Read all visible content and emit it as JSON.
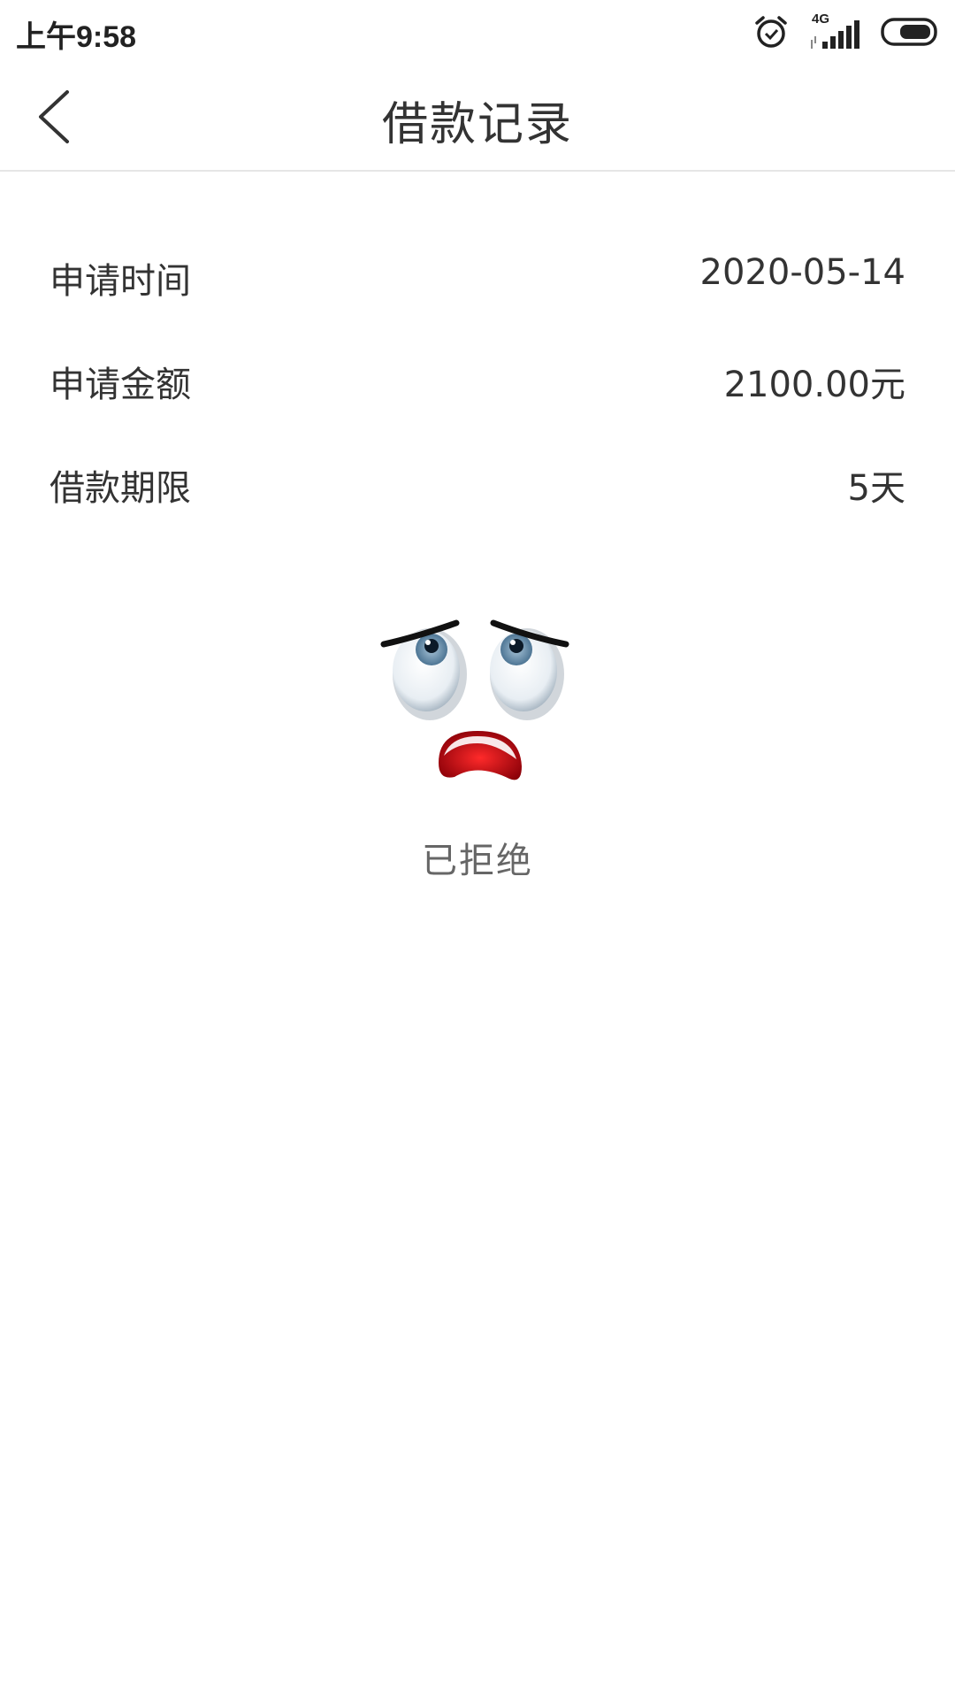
{
  "status_bar": {
    "time": "上午9:58",
    "network": "4G"
  },
  "nav": {
    "title": "借款记录"
  },
  "record": {
    "rows": [
      {
        "label": "申请时间",
        "value": "2020-05-14"
      },
      {
        "label": "申请金额",
        "value": "2100.00元"
      },
      {
        "label": "借款期限",
        "value": "5天"
      }
    ]
  },
  "result": {
    "status_text": "已拒绝",
    "icon": "sad-face-icon"
  },
  "colors": {
    "text_primary": "#333333",
    "text_secondary": "#666666",
    "divider": "#e6e6e6",
    "mouth_red": "#c0101a"
  }
}
